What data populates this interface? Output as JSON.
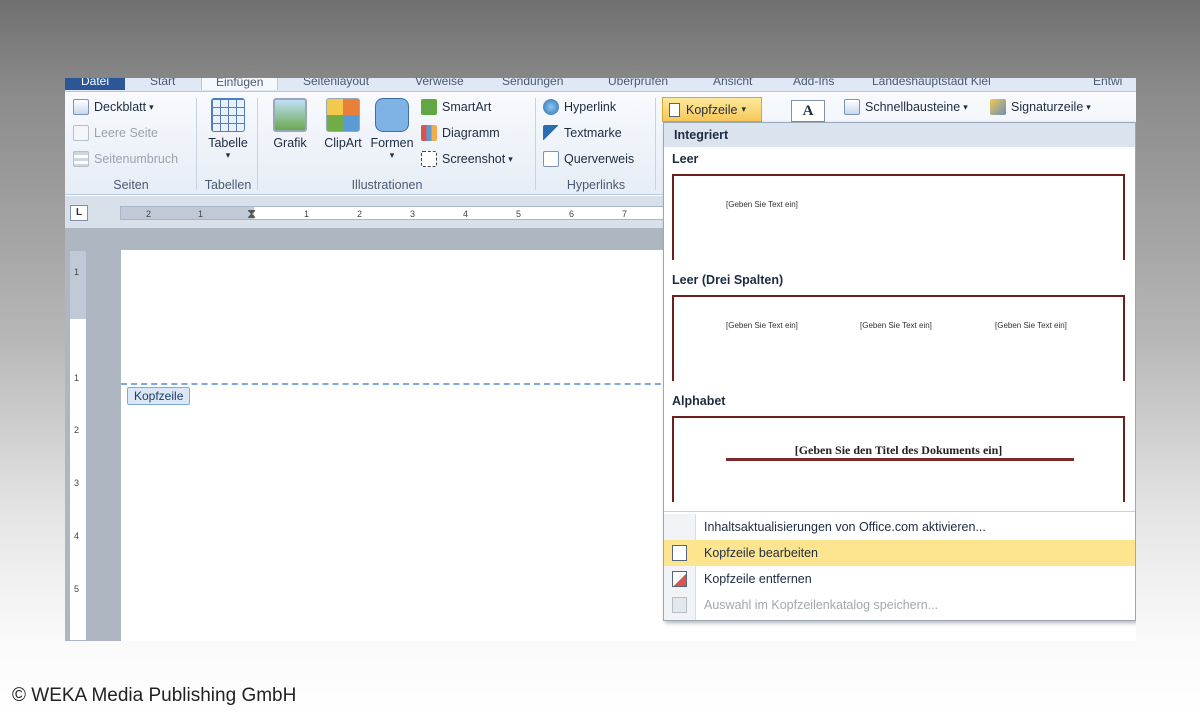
{
  "tabs": [
    "Datei",
    "Start",
    "Einfügen",
    "Seitenlayout",
    "Verweise",
    "Sendungen",
    "Überprüfen",
    "Ansicht",
    "Add-Ins",
    "Landeshauptstadt Kiel",
    "Entwi"
  ],
  "ribbon": {
    "seiten": {
      "deckblatt": "Deckblatt",
      "leere_seite": "Leere Seite",
      "seitenumbruch": "Seitenumbruch",
      "group": "Seiten"
    },
    "tabellen": {
      "tabelle": "Tabelle",
      "group": "Tabellen"
    },
    "illustrationen": {
      "grafik": "Grafik",
      "clipart": "ClipArt",
      "formen": "Formen",
      "smartart": "SmartArt",
      "diagramm": "Diagramm",
      "screenshot": "Screenshot",
      "group": "Illustrationen"
    },
    "hyperlinks": {
      "hyperlink": "Hyperlink",
      "textmarke": "Textmarke",
      "querverweis": "Querverweis",
      "group": "Hyperlinks"
    },
    "kopfzeile": "Kopfzeile",
    "schnellbausteine": "Schnellbausteine",
    "signaturzeile": "Signaturzeile"
  },
  "ruler": {
    "corner": "L",
    "ticks": [
      "2",
      "1",
      "1",
      "2",
      "3",
      "4",
      "5",
      "6",
      "7"
    ],
    "vticks": [
      "1",
      "1",
      "2",
      "3",
      "4",
      "5"
    ]
  },
  "document": {
    "header_tag": "Kopfzeile"
  },
  "dropdown": {
    "heading": "Integriert",
    "galleries": [
      {
        "title": "Leer",
        "placeholder": "[Geben Sie Text ein]"
      },
      {
        "title": "Leer (Drei Spalten)",
        "placeholders": [
          "[Geben Sie Text ein]",
          "[Geben Sie Text ein]",
          "[Geben Sie Text ein]"
        ]
      },
      {
        "title": "Alphabet",
        "doc_title": "[Geben Sie den Titel des Dokuments ein]"
      }
    ],
    "menu": [
      {
        "label": "Inhaltsaktualisierungen von Office.com aktivieren...",
        "state": "normal"
      },
      {
        "label": "Kopfzeile bearbeiten",
        "state": "highlighted"
      },
      {
        "label": "Kopfzeile entfernen",
        "state": "normal"
      },
      {
        "label": "Auswahl im Kopfzeilenkatalog speichern...",
        "state": "disabled"
      }
    ]
  },
  "copyright": "© WEKA Media Publishing GmbH",
  "colors": {
    "accent": "#2b5797",
    "highlight": "#fce58e",
    "gallery_border": "#6b1f1f"
  }
}
